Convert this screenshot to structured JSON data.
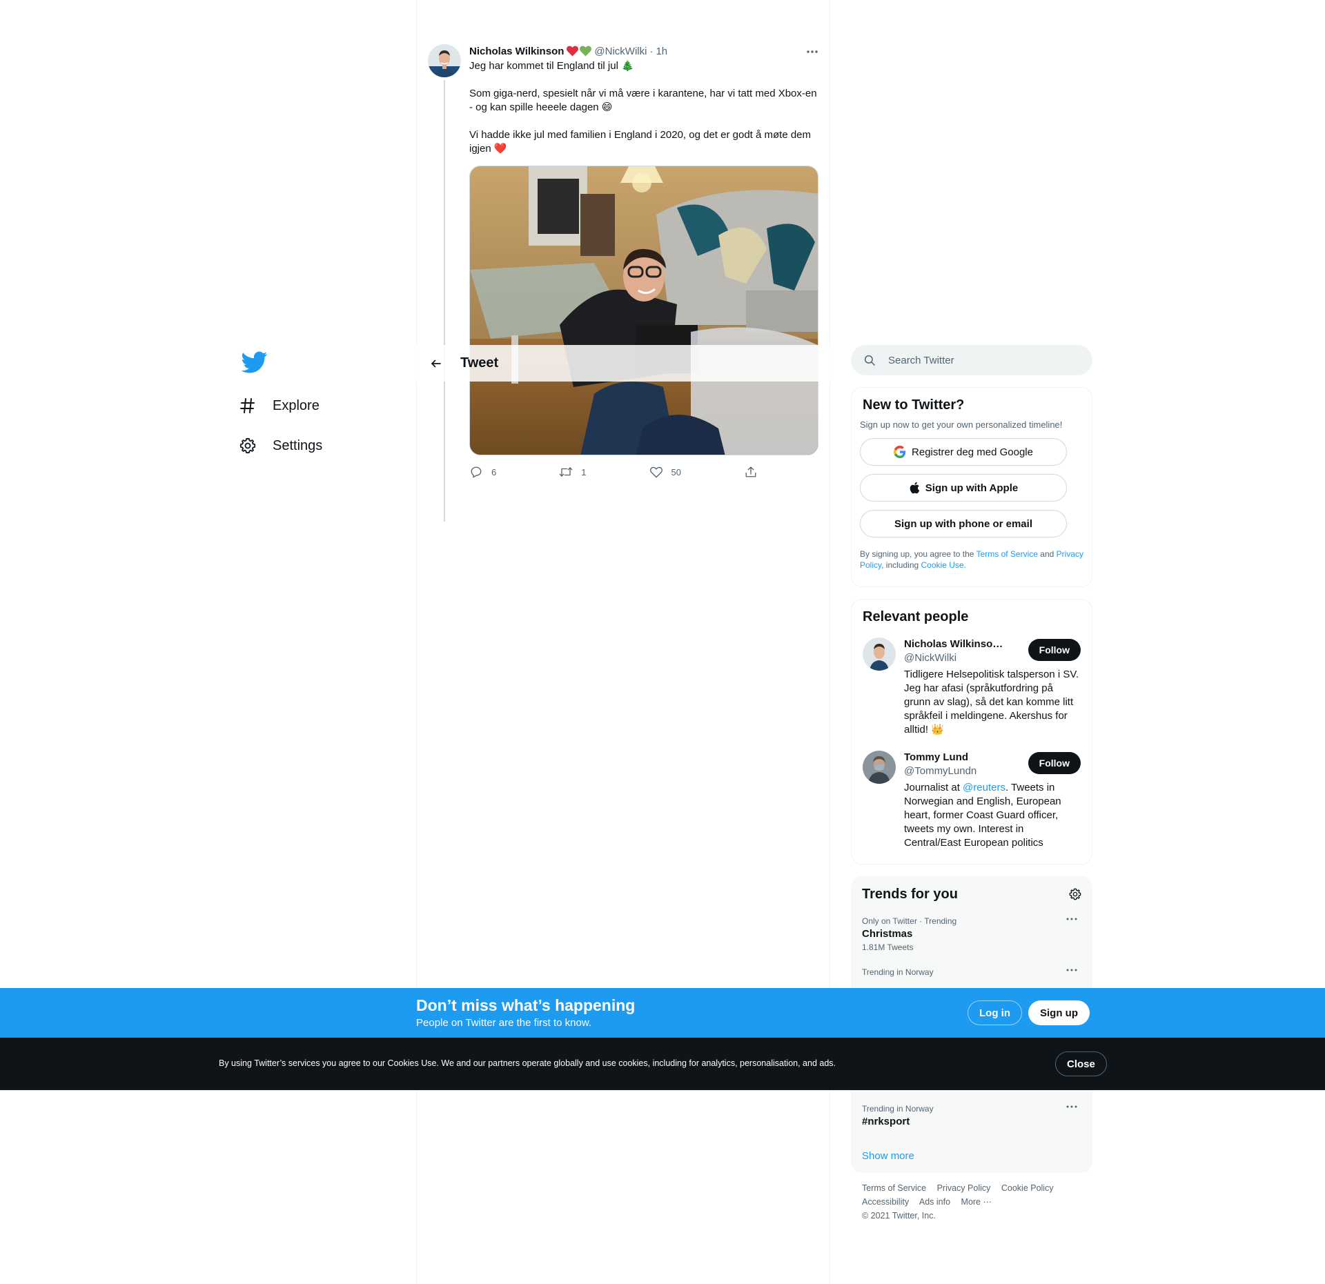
{
  "nav": {
    "items": [
      {
        "label": "Explore",
        "icon": "hashtag-icon"
      },
      {
        "label": "Settings",
        "icon": "gear-icon"
      }
    ]
  },
  "header": {
    "title": "Tweet"
  },
  "tweet": {
    "author_name": "Nicholas Wilkinson",
    "handle": "@NickWilki",
    "dot": "·",
    "time": "1h",
    "paragraphs": [
      "Jeg har kommet til England til jul 🎄",
      "Som giga-nerd, spesielt når vi må være i karantene, har vi tatt med Xbox-en - og kan spille heeele dagen 😄",
      "Vi hadde ikke jul med familien i England i 2020, og det er godt å møte dem igjen ❤️"
    ],
    "replies": "6",
    "retweets": "1",
    "likes": "50"
  },
  "search": {
    "placeholder": "Search Twitter"
  },
  "signup": {
    "title": "New to Twitter?",
    "subtitle": "Sign up now to get your own personalized timeline!",
    "google_label": "Registrer deg med Google",
    "apple_label": "Sign up with Apple",
    "phone_label": "Sign up with phone or email",
    "legal_prefix": "By signing up, you agree to the",
    "terms_link": "Terms of Service",
    "and": "and",
    "privacy_link": "Privacy Policy",
    "including": ", including",
    "cookie_link": "Cookie Use."
  },
  "people": {
    "title": "Relevant people",
    "list": [
      {
        "name": "Nicholas Wilkinson ...",
        "handle": "@NickWilki",
        "bio": "Tidligere Helsepolitisk talsperson i SV. Jeg har afasi (språkutfordring på grunn av slag), så det kan komme litt språkfeil i meldingene. Akershus for alltid! 👑",
        "follow": "Follow"
      },
      {
        "name": "Tommy Lund",
        "handle": "@TommyLundn",
        "bio_prefix": "Journalist at ",
        "bio_link": "@reuters",
        "bio_suffix": ". Tweets in Norwegian and English, European heart, former Coast Guard officer, tweets my own. Interest in Central/East European politics",
        "follow": "Follow"
      }
    ]
  },
  "trends": {
    "title": "Trends for you",
    "items": [
      {
        "meta": "Only on Twitter · Trending",
        "name": "Christmas",
        "count": "1.81M Tweets"
      },
      {
        "meta": "Trending in Norway",
        "name": "",
        "count": ""
      },
      {
        "meta": "Trending in Norway",
        "name": "#nrksport",
        "count": ""
      }
    ],
    "show_more": "Show more"
  },
  "footer": {
    "links": [
      "Terms of Service",
      "Privacy Policy",
      "Cookie Policy",
      "Accessibility",
      "Ads info",
      "More ···"
    ],
    "copyright": "© 2021 Twitter, Inc."
  },
  "banner": {
    "title": "Don’t miss what’s happening",
    "subtitle": "People on Twitter are the first to know.",
    "login": "Log in",
    "signup": "Sign up"
  },
  "cookie": {
    "text": "By using Twitter’s services you agree to our Cookies Use. We and our partners operate globally and use cookies, including for analytics, personalisation, and ads.",
    "close": "Close"
  },
  "colors": {
    "accent": "#1d9bf0",
    "text": "#0f1419",
    "muted": "#536471",
    "dark": "#0f1419"
  }
}
